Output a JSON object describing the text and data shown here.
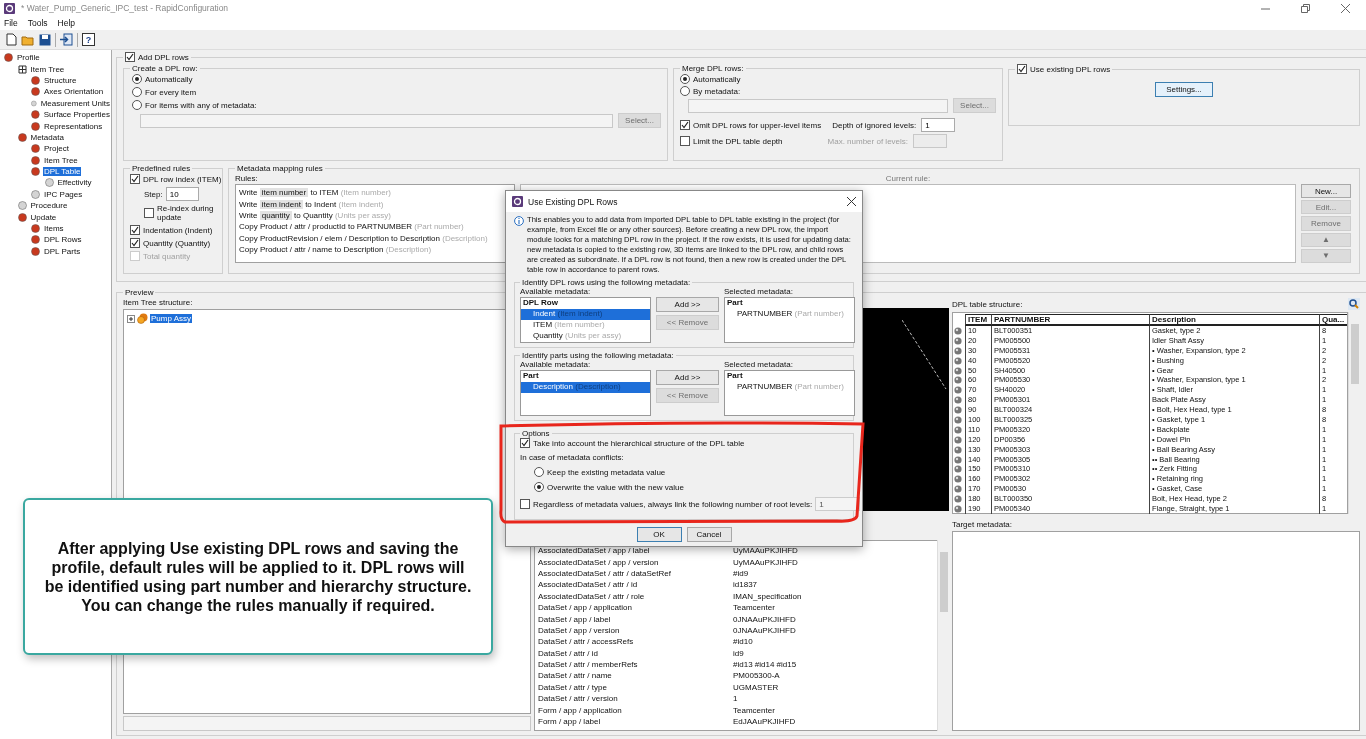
{
  "window": {
    "title": "* Water_Pump_Generic_IPC_test - RapidConfiguration"
  },
  "menu": [
    "File",
    "Tools",
    "Help"
  ],
  "toolbar": [
    {
      "kind": "new"
    },
    {
      "kind": "open"
    },
    {
      "kind": "save"
    },
    {
      "kind": "separator"
    },
    {
      "kind": "export"
    },
    {
      "kind": "separator"
    },
    {
      "kind": "help",
      "glyph": "?"
    }
  ],
  "sidebar": {
    "items": [
      {
        "label": "Profile",
        "kind": "ball",
        "color": "#c8391e",
        "selected": false,
        "children": [
          {
            "label": "Item Tree",
            "kind": "tree",
            "selected": false,
            "children": [
              {
                "label": "Structure",
                "kind": "ball",
                "color": "#c8391e",
                "selected": false
              },
              {
                "label": "Axes Orientation",
                "kind": "ball",
                "color": "#c8391e",
                "selected": false
              },
              {
                "label": "Measurement Units",
                "kind": "ball",
                "color": "#d4d4d4",
                "selected": false
              },
              {
                "label": "Surface Properties",
                "kind": "ball",
                "color": "#c8391e",
                "selected": false
              },
              {
                "label": "Representations",
                "kind": "ball",
                "color": "#c8391e",
                "selected": false
              }
            ]
          },
          {
            "label": "Metadata",
            "kind": "ball",
            "color": "#c8391e",
            "selected": false,
            "children": [
              {
                "label": "Project",
                "kind": "ball",
                "color": "#c8391e",
                "selected": false
              },
              {
                "label": "Item Tree",
                "kind": "ball",
                "color": "#c8391e",
                "selected": false
              },
              {
                "label": "DPL Table",
                "kind": "ball",
                "color": "#c8391e",
                "selected": true,
                "children": [
                  {
                    "label": "Effectivity",
                    "kind": "ball",
                    "color": "#d4d4d4",
                    "selected": false
                  }
                ]
              },
              {
                "label": "IPC Pages",
                "kind": "ball",
                "color": "#d4d4d4",
                "selected": false
              }
            ]
          },
          {
            "label": "Procedure",
            "kind": "ball",
            "color": "#d4d4d4",
            "selected": false
          },
          {
            "label": "Update",
            "kind": "ball",
            "color": "#c8391e",
            "selected": false,
            "children": [
              {
                "label": "Items",
                "kind": "ball",
                "color": "#c8391e",
                "selected": false
              },
              {
                "label": "DPL Rows",
                "kind": "ball",
                "color": "#c8391e",
                "selected": false
              },
              {
                "label": "DPL Parts",
                "kind": "ball",
                "color": "#c8391e",
                "selected": false
              }
            ]
          }
        ]
      }
    ]
  },
  "add_dpl_rows": {
    "label": "Add DPL rows",
    "checked": true,
    "create": {
      "title": "Create a DPL row:",
      "options": [
        {
          "label": "Automatically",
          "selected": true
        },
        {
          "label": "For every item",
          "selected": false
        },
        {
          "label": "For items with any of metadata:",
          "selected": false
        }
      ],
      "select_button": {
        "label": "Select...",
        "disabled": true
      }
    },
    "merge": {
      "title": "Merge DPL rows:",
      "options": [
        {
          "label": "Automatically",
          "selected": true
        },
        {
          "label": "By metadata:",
          "selected": false
        }
      ],
      "select_button": {
        "label": "Select...",
        "disabled": true
      },
      "omit": {
        "label": "Omit DPL rows for upper-level items",
        "checked": true
      },
      "depth": {
        "label": "Depth of ignored levels:",
        "value": "1"
      },
      "limit": {
        "label": "Limit the DPL table depth",
        "checked": false
      },
      "max_levels": {
        "label": "Max. number of levels:",
        "disabled": true
      }
    },
    "use_existing": {
      "label": "Use existing DPL rows",
      "checked": true,
      "settings_button": "Settings..."
    },
    "predefined": {
      "title": "Predefined rules",
      "row_index": {
        "label": "DPL row index (ITEM)",
        "checked": true
      },
      "step": {
        "label": "Step:",
        "value": "10"
      },
      "reindex": {
        "label": "Re-index during update",
        "checked": false
      },
      "indentation": {
        "label": "Indentation (Indent)",
        "checked": true
      },
      "quantity": {
        "label": "Quantity (Quantity)",
        "checked": true
      },
      "total": {
        "label": "Total quantity",
        "checked": false,
        "disabled": true
      }
    },
    "mapping": {
      "title": "Metadata mapping rules",
      "rules_label": "Rules:",
      "current_rule_label": "Current rule:",
      "rules": [
        {
          "kind": "write",
          "verb": "Write",
          "token": "item number",
          "target": "to ITEM",
          "hint": "(Item number)"
        },
        {
          "kind": "write",
          "verb": "Write",
          "token": "item indent",
          "target": "to Indent",
          "hint": "(Item indent)"
        },
        {
          "kind": "write",
          "verb": "Write",
          "token": "quantity",
          "target": "to Quantity",
          "hint": "(Units per assy)"
        },
        {
          "kind": "copy",
          "text": "Copy Product / attr / productId to PARTNUMBER",
          "hint": "(Part number)"
        },
        {
          "kind": "copy",
          "text": "Copy ProductRevision / elem / Description to Description",
          "hint": "(Description)"
        },
        {
          "kind": "copy",
          "text": "Copy Product / attr / name to Description",
          "hint": "(Description)"
        }
      ],
      "buttons": [
        {
          "label": "New...",
          "disabled": false
        },
        {
          "label": "Edit...",
          "disabled": true
        },
        {
          "label": "Remove",
          "disabled": true
        },
        {
          "label": "▲",
          "disabled": true
        },
        {
          "label": "▼",
          "disabled": true
        }
      ]
    }
  },
  "preview": {
    "title": "Preview",
    "item_tree": {
      "label": "Item Tree structure:",
      "root": {
        "label": "Pump Assy",
        "selected": true,
        "expanded": false
      }
    },
    "dpl_table": {
      "label": "DPL table structure:",
      "columns": [
        "ITEM",
        "PARTNUMBER",
        "Description",
        "Qua..."
      ],
      "rows": [
        {
          "item": "10",
          "partnumber": "BLT000351",
          "description": "Gasket, type 2",
          "quantity": "8"
        },
        {
          "item": "20",
          "partnumber": "PM005500",
          "description": "Idler Shaft Assy",
          "quantity": "1"
        },
        {
          "item": "30",
          "partnumber": "PM005531",
          "description": "• Washer, Expansion, type 2",
          "quantity": "2"
        },
        {
          "item": "40",
          "partnumber": "PM005520",
          "description": "• Bushing",
          "quantity": "2"
        },
        {
          "item": "50",
          "partnumber": "SH40500",
          "description": "• Gear",
          "quantity": "1"
        },
        {
          "item": "60",
          "partnumber": "PM005530",
          "description": "• Washer, Expansion, type 1",
          "quantity": "2"
        },
        {
          "item": "70",
          "partnumber": "SH40020",
          "description": "• Shaft, Idler",
          "quantity": "1"
        },
        {
          "item": "80",
          "partnumber": "PM005301",
          "description": "Back Plate Assy",
          "quantity": "1"
        },
        {
          "item": "90",
          "partnumber": "BLT000324",
          "description": "• Bolt, Hex Head, type 1",
          "quantity": "8"
        },
        {
          "item": "100",
          "partnumber": "BLT000325",
          "description": "• Gasket, type 1",
          "quantity": "8"
        },
        {
          "item": "110",
          "partnumber": "PM005320",
          "description": "• Backplate",
          "quantity": "1"
        },
        {
          "item": "120",
          "partnumber": "DP00356",
          "description": "• Dowel Pin",
          "quantity": "1"
        },
        {
          "item": "130",
          "partnumber": "PM005303",
          "description": "• Ball Bearing Assy",
          "quantity": "1"
        },
        {
          "item": "140",
          "partnumber": "PM005305",
          "description": "•• Ball Bearing",
          "quantity": "1"
        },
        {
          "item": "150",
          "partnumber": "PM005310",
          "description": "•• Zerk Fitting",
          "quantity": "1"
        },
        {
          "item": "160",
          "partnumber": "PM005302",
          "description": "• Retaining ring",
          "quantity": "1"
        },
        {
          "item": "170",
          "partnumber": "PM00530",
          "description": "• Gasket, Case",
          "quantity": "1"
        },
        {
          "item": "180",
          "partnumber": "BLT000350",
          "description": "Bolt, Hex Head, type 2",
          "quantity": "8"
        },
        {
          "item": "190",
          "partnumber": "PM005340",
          "description": "Flange, Straight, type 1",
          "quantity": "1"
        }
      ]
    },
    "target_label": "Target metadata:",
    "source_metadata": [
      {
        "name": "AssociatedDataSet / app / label",
        "value": "UyMAAuPKJIHFD"
      },
      {
        "name": "AssociatedDataSet / app / version",
        "value": "UyMAAuPKJIHFD"
      },
      {
        "name": "AssociatedDataSet / attr / dataSetRef",
        "value": "#id9"
      },
      {
        "name": "AssociatedDataSet / attr / id",
        "value": "id1837"
      },
      {
        "name": "AssociatedDataSet / attr / role",
        "value": "IMAN_specification"
      },
      {
        "name": "DataSet / app / application",
        "value": "Teamcenter"
      },
      {
        "name": "DataSet / app / label",
        "value": "0JNAAuPKJIHFD"
      },
      {
        "name": "DataSet / app / version",
        "value": "0JNAAuPKJIHFD"
      },
      {
        "name": "DataSet / attr / accessRefs",
        "value": "#id10"
      },
      {
        "name": "DataSet / attr / id",
        "value": "id9"
      },
      {
        "name": "DataSet / attr / memberRefs",
        "value": "#id13 #id14 #id15"
      },
      {
        "name": "DataSet / attr / name",
        "value": "PM005300-A"
      },
      {
        "name": "DataSet / attr / type",
        "value": "UGMASTER"
      },
      {
        "name": "DataSet / attr / version",
        "value": "1"
      },
      {
        "name": "Form / app / application",
        "value": "Teamcenter"
      },
      {
        "name": "Form / app / label",
        "value": "EdJAAuPKJIHFD"
      }
    ]
  },
  "dialog": {
    "title": "Use Existing DPL Rows",
    "info": "This enables you to add data from imported DPL table to DPL table existing in the project (for example, from Excel file or any other sources). Before creating a new DPL row, the import module looks for a matching DPL row in the project. If the row exists, it is used for updating data: new metadata is copied to the existing row, 3D items are linked to the DPL row, and child rows are created as subordinate. If a DPL row is not found, then a new row is created under the DPL table row in accordance to parent rows.",
    "sections": [
      {
        "title": "Identify DPL rows using the following metadata:",
        "available_label": "Available metadata:",
        "available_header": "DPL Row",
        "available": [
          {
            "name": "Indent",
            "hint": "(Item indent)",
            "selected": true
          },
          {
            "name": "ITEM",
            "hint": "(Item number)",
            "selected": false
          },
          {
            "name": "Quantity",
            "hint": "(Units per assy)",
            "selected": false
          }
        ],
        "add_button": {
          "label": "Add >>",
          "disabled": false
        },
        "remove_button": {
          "label": "<< Remove",
          "disabled": true
        },
        "selected_label": "Selected metadata:",
        "selected_header": "Part",
        "selected": [
          {
            "name": "PARTNUMBER",
            "hint": "(Part number)"
          }
        ]
      },
      {
        "title": "Identify parts using the following metadata:",
        "available_label": "Available metadata:",
        "available_header": "Part",
        "available": [
          {
            "name": "Description",
            "hint": "(Description)",
            "selected": true
          }
        ],
        "add_button": {
          "label": "Add >>",
          "disabled": false
        },
        "remove_button": {
          "label": "<< Remove",
          "disabled": true
        },
        "selected_label": "Selected metadata:",
        "selected_header": "Part",
        "selected": [
          {
            "name": "PARTNUMBER",
            "hint": "(Part number)"
          }
        ]
      }
    ],
    "options": {
      "title": "Options",
      "hierarchy": {
        "label": "Take into account the hierarchical structure of the DPL table",
        "checked": true
      },
      "conflicts_label": "In case of metadata conflicts:",
      "conflict_options": [
        {
          "label": "Keep the existing metadata value",
          "selected": false
        },
        {
          "label": "Overwrite the value with the new value",
          "selected": true
        }
      ],
      "root_levels": {
        "label": "Regardless of metadata values, always link the following number of root levels:",
        "checked": false,
        "value": "1",
        "field_disabled": true
      }
    },
    "ok": "OK",
    "cancel": "Cancel"
  },
  "callout": {
    "text": "After applying Use existing DPL rows and saving the profile, default rules will be applied to it. DPL rows will be identified using part number and hierarchy structure. You can change the rules manually if required."
  }
}
